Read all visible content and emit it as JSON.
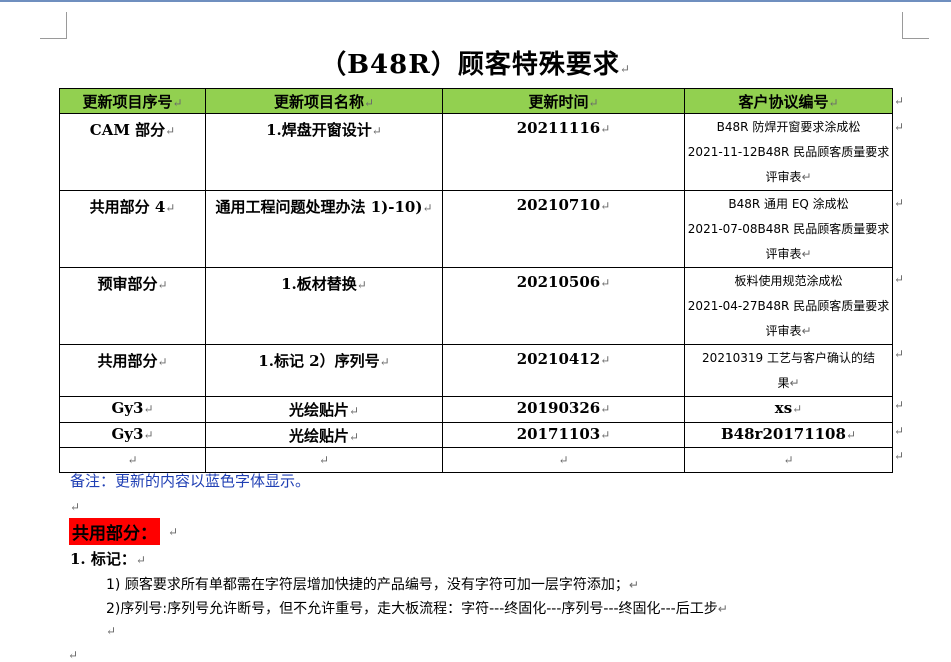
{
  "page": {
    "title": "（B48R）顾客特殊要求",
    "para_mark": "↵"
  },
  "table": {
    "headers": [
      "更新项目序号",
      "更新项目名称",
      "更新时间",
      "客户协议编号"
    ],
    "rows": [
      {
        "seq": "CAM 部分",
        "name": "1.焊盘开窗设计",
        "date": "20211116",
        "agreement": [
          "B48R 防焊开窗要求涂成松",
          "2021-11-12B48R 民品顾客质量要求",
          "评审表"
        ]
      },
      {
        "seq": "共用部分 4",
        "name": "通用工程问题处理办法 1)-10)",
        "date": "20210710",
        "agreement": [
          "B48R 通用 EQ 涂成松",
          "2021-07-08B48R 民品顾客质量要求",
          "评审表"
        ]
      },
      {
        "seq": "预审部分",
        "name": "1.板材替换",
        "date": "20210506",
        "agreement": [
          "板料使用规范涂成松",
          "2021-04-27B48R 民品顾客质量要求",
          "评审表"
        ]
      },
      {
        "seq": "共用部分",
        "name": "1.标记 2）序列号",
        "date": "20210412",
        "agreement": [
          "20210319 工艺与客户确认的结",
          "果"
        ]
      },
      {
        "seq": "Gy3",
        "name": "光绘贴片",
        "date": "20190326",
        "agreement": [
          "xs"
        ]
      },
      {
        "seq": "Gy3",
        "name": "光绘贴片",
        "date": "20171103",
        "agreement": [
          "B48r20171108"
        ]
      },
      {
        "seq": "",
        "name": "",
        "date": "",
        "agreement": [
          ""
        ]
      }
    ]
  },
  "notes": {
    "remark": "备注：更新的内容以蓝色字体显示。",
    "section_label": "共用部分：",
    "item1_title": "1.    标记：",
    "item1_line1": "1)   顾客要求所有单都需在字符层增加快捷的产品编号，没有字符可加一层字符添加；",
    "item1_line2": "2)序列号:序列号允许断号，但不允许重号，走大板流程：字符---终固化---序列号---终固化---后工步"
  }
}
